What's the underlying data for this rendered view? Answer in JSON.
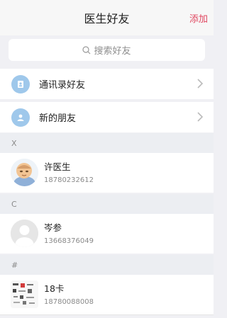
{
  "header": {
    "title": "医生好友",
    "add_label": "添加"
  },
  "search": {
    "placeholder": "搜索好友"
  },
  "nav": [
    {
      "label": "通讯录好友"
    },
    {
      "label": "新的朋友"
    }
  ],
  "sections": [
    {
      "letter": "X",
      "contacts": [
        {
          "name": "许医生",
          "phone": "18780232612"
        }
      ]
    },
    {
      "letter": "C",
      "contacts": [
        {
          "name": "岑参",
          "phone": "13668376049"
        }
      ]
    },
    {
      "letter": "#",
      "contacts": [
        {
          "name": "18卡",
          "phone": "18780088008"
        }
      ]
    }
  ],
  "colors": {
    "accent": "#e0465f",
    "nav_icon_bg": "#9fc8eb"
  }
}
